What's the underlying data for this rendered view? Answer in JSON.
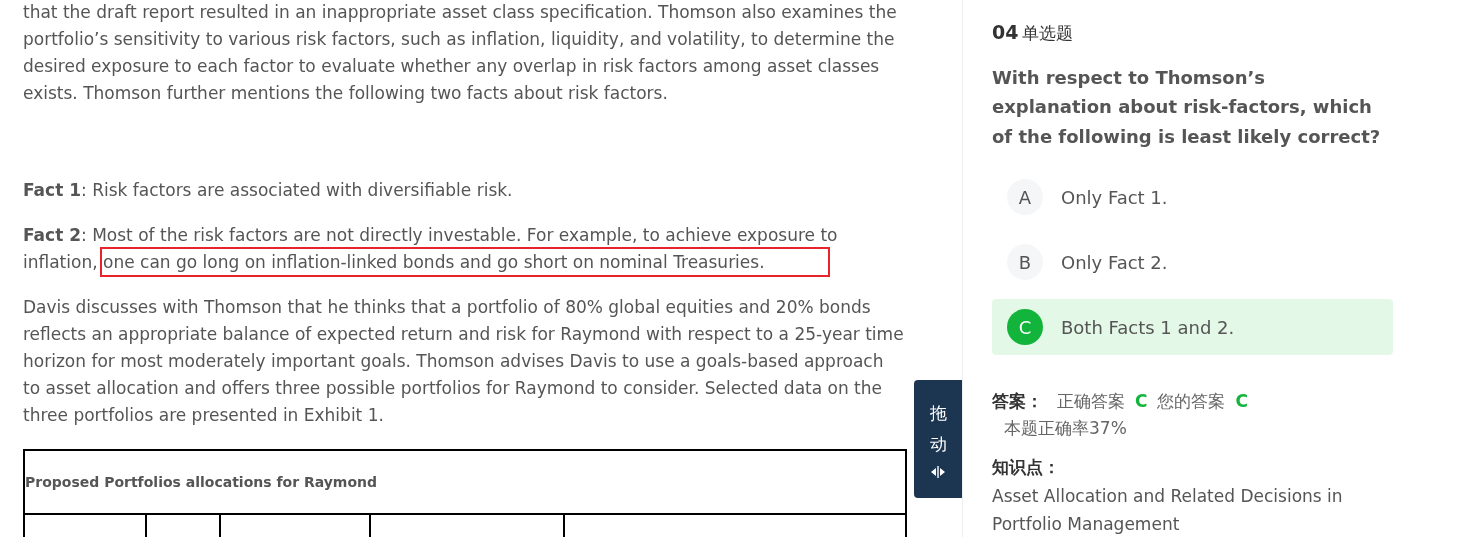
{
  "passage": {
    "paragraphs": [
      {
        "text": "that the draft report resulted in an inappropriate asset class specification. Thomson also examines the portfolio’s sensitivity to various risk factors, such as inflation, liquidity, and volatility, to determine the desired exposure to each factor to evaluate whether any overlap in risk factors among asset classes exists. Thomson further mentions the following two facts about risk factors.",
        "highlighted": false
      },
      {
        "text": "**Fact 1**: Risk factors are associated with diversifiable risk.",
        "highlighted": false
      },
      {
        "text": "**Fact 2**: Most of the risk factors are not directly investable. For example, to achieve exposure to inflation, one can go long on inflation-linked bonds and go short on nominal Treasuries.",
        "highlighted": true
      },
      {
        "text": "Davis discusses with Thomson that he thinks that a portfolio of 80% global equities and 20% bonds reflects an appropriate balance of expected return and risk for Raymond with respect to a 25-year time horizon for most moderately important goals. Thomson advises Davis to use a goals-based approach to asset allocation and offers three possible portfolios for Raymond to consider. Selected data on the three portfolios are presented in Exhibit 1.",
        "highlighted": false
      }
    ],
    "table": {
      "title": "Proposed Portfolios allocations for Raymond"
    }
  },
  "drag_handle": {
    "label": "拖动"
  },
  "question": {
    "number": "04",
    "type": "单选题",
    "text": "With respect to Thomson’s explanation about risk-factors, which of the following is least likely correct?",
    "options": [
      {
        "letter": "A",
        "text": "Only Fact 1.",
        "selected": false
      },
      {
        "letter": "B",
        "text": "Only Fact 2.",
        "selected": false
      },
      {
        "letter": "C",
        "text": "Both Facts 1 and 2.",
        "selected": true
      }
    ],
    "answer": {
      "label": "答案：",
      "correct_label": "正确答案",
      "correct": "C",
      "yours_label": "您的答案",
      "yours": "C",
      "rate": "本题正确率37%"
    },
    "knowledge": {
      "label": "知识点：",
      "text": "Asset Allocation and Related Decisions in Portfolio Management"
    }
  }
}
